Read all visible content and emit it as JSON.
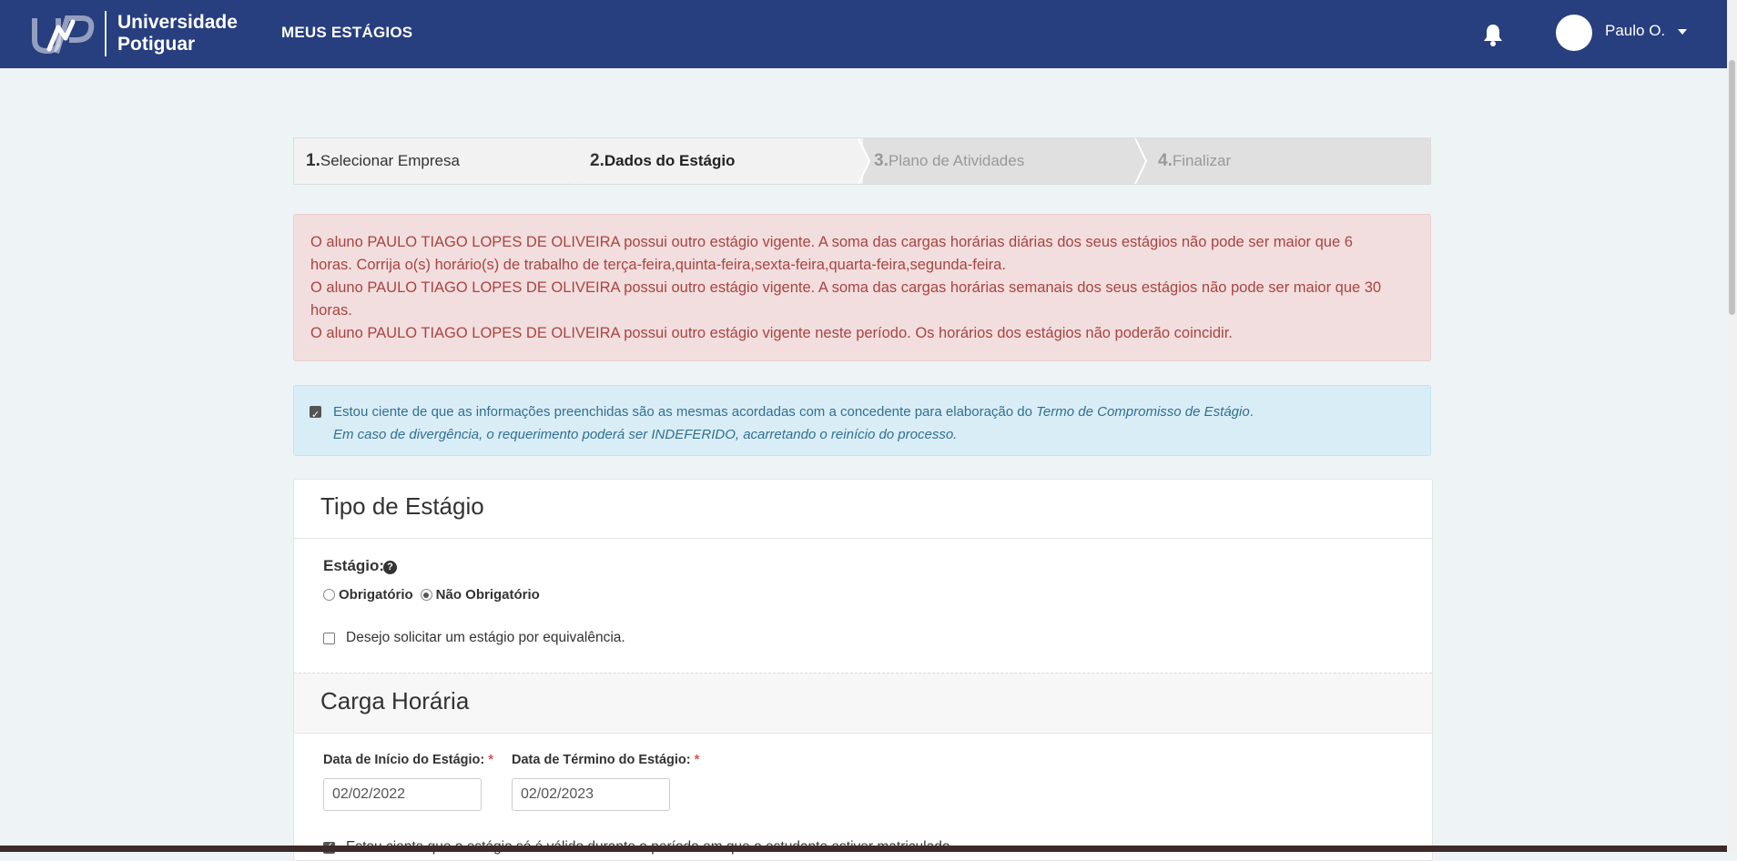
{
  "navbar": {
    "logo_text_line1": "Universidade",
    "logo_text_line2": "Potiguar",
    "nav_link": "MEUS ESTÁGIOS",
    "user_name": "Paulo O."
  },
  "wizard": {
    "steps": [
      {
        "num": "1.",
        "label": " Selecionar Empresa",
        "state": "done"
      },
      {
        "num": "2.",
        "label": " Dados do Estágio",
        "state": "active"
      },
      {
        "num": "3.",
        "label": " Plano de Atividades",
        "state": "pending"
      },
      {
        "num": "4.",
        "label": " Finalizar",
        "state": "pending"
      }
    ]
  },
  "alert_danger": {
    "line1": "O aluno PAULO TIAGO LOPES DE OLIVEIRA possui outro estágio vigente. A soma das cargas horárias diárias dos seus estágios não pode ser maior que 6",
    "line2": "horas. Corrija o(s) horário(s) de trabalho de terça-feira,quinta-feira,sexta-feira,quarta-feira,segunda-feira.",
    "line3": "O aluno PAULO TIAGO LOPES DE OLIVEIRA possui outro estágio vigente. A soma das cargas horárias semanais dos seus estágios não pode ser maior que 30",
    "line4": "horas.",
    "line5": "O aluno PAULO TIAGO LOPES DE OLIVEIRA possui outro estágio vigente neste período. Os horários dos estágios não poderão coincidir."
  },
  "alert_info": {
    "text_prefix": "Estou ciente de que as informações preenchidas são as mesmas acordadas com a concedente para elaboração do ",
    "text_italic": "Termo de Compromisso de Estágio",
    "text_suffix": ".",
    "line2": "Em caso de divergência, o requerimento poderá ser INDEFERIDO, acarretando o reinício do processo.",
    "checked": true
  },
  "tipo_estagio": {
    "title": "Tipo de Estágio",
    "estagio_label": "Estágio:",
    "options": [
      "Obrigatório",
      "Não Obrigatório"
    ],
    "selected": "Não Obrigatório",
    "equivalencia_label": "Desejo solicitar um estágio por equivalência.",
    "equivalencia_checked": false
  },
  "carga_horaria": {
    "title": "Carga Horária",
    "inicio_label": "Data de Início do Estágio:",
    "inicio_value": "02/02/2022",
    "termino_label": "Data de Término do Estágio:",
    "termino_value": "02/02/2023",
    "required_mark": "*",
    "ciente_label": "Estou ciente que o estágio só é válido durante o período em que o estudante estiver matriculado.",
    "ciente_checked": true
  }
}
